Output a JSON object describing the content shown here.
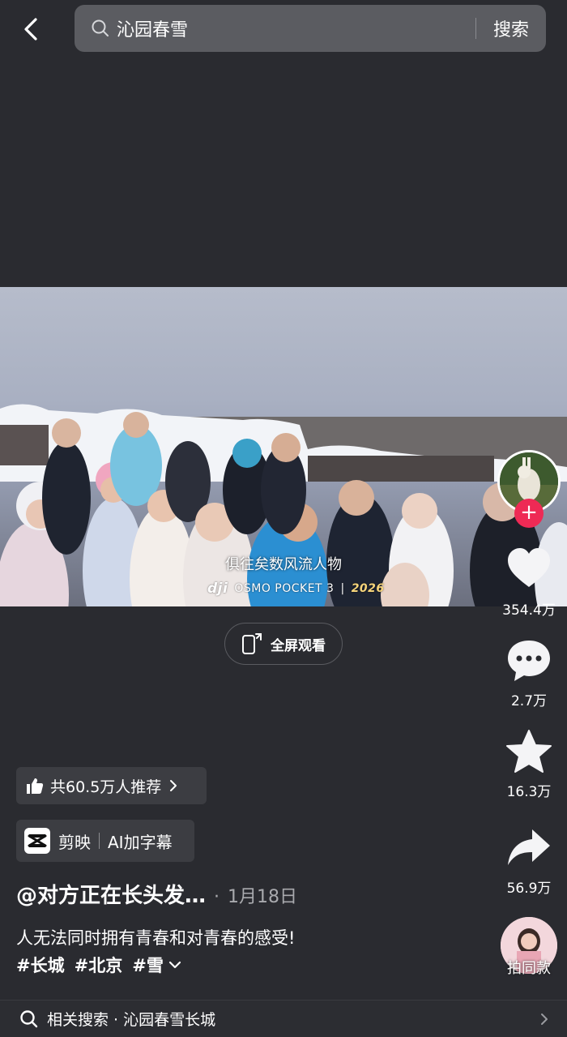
{
  "search": {
    "query": "沁园春雪",
    "button_label": "搜索"
  },
  "video": {
    "caption": "俱往矣数风流人物",
    "watermark_brand": "dji",
    "watermark_model": "OSMO POCKET 3",
    "watermark_year": "2026",
    "fullscreen_label": "全屏观看"
  },
  "rail": {
    "likes": "354.4万",
    "comments": "2.7万",
    "favorites": "16.3万",
    "shares": "56.9万",
    "same_style_label": "拍同款"
  },
  "info": {
    "recommend": "共60.5万人推荐",
    "app_name": "剪映",
    "app_action": "AI加字幕",
    "author": "@对方正在长头发…",
    "separator": "·",
    "date": "1月18日",
    "description": "人无法同时拥有青春和对青春的感受!",
    "tags": [
      "#长城",
      "#北京",
      "#雪"
    ]
  },
  "related": {
    "label": "相关搜索 · 沁园春雪长城"
  },
  "colors": {
    "background": "#2a2b30",
    "follow_accent": "#ee2a55",
    "pill_bg": "#3c3d42"
  },
  "icons": [
    "back-arrow-icon",
    "search-icon",
    "heart-icon",
    "comment-icon",
    "star-icon",
    "share-icon",
    "plus-icon",
    "thumbs-up-icon",
    "chevron-right-icon",
    "chevron-down-icon",
    "fullscreen-phone-icon",
    "capcut-logo-icon"
  ]
}
